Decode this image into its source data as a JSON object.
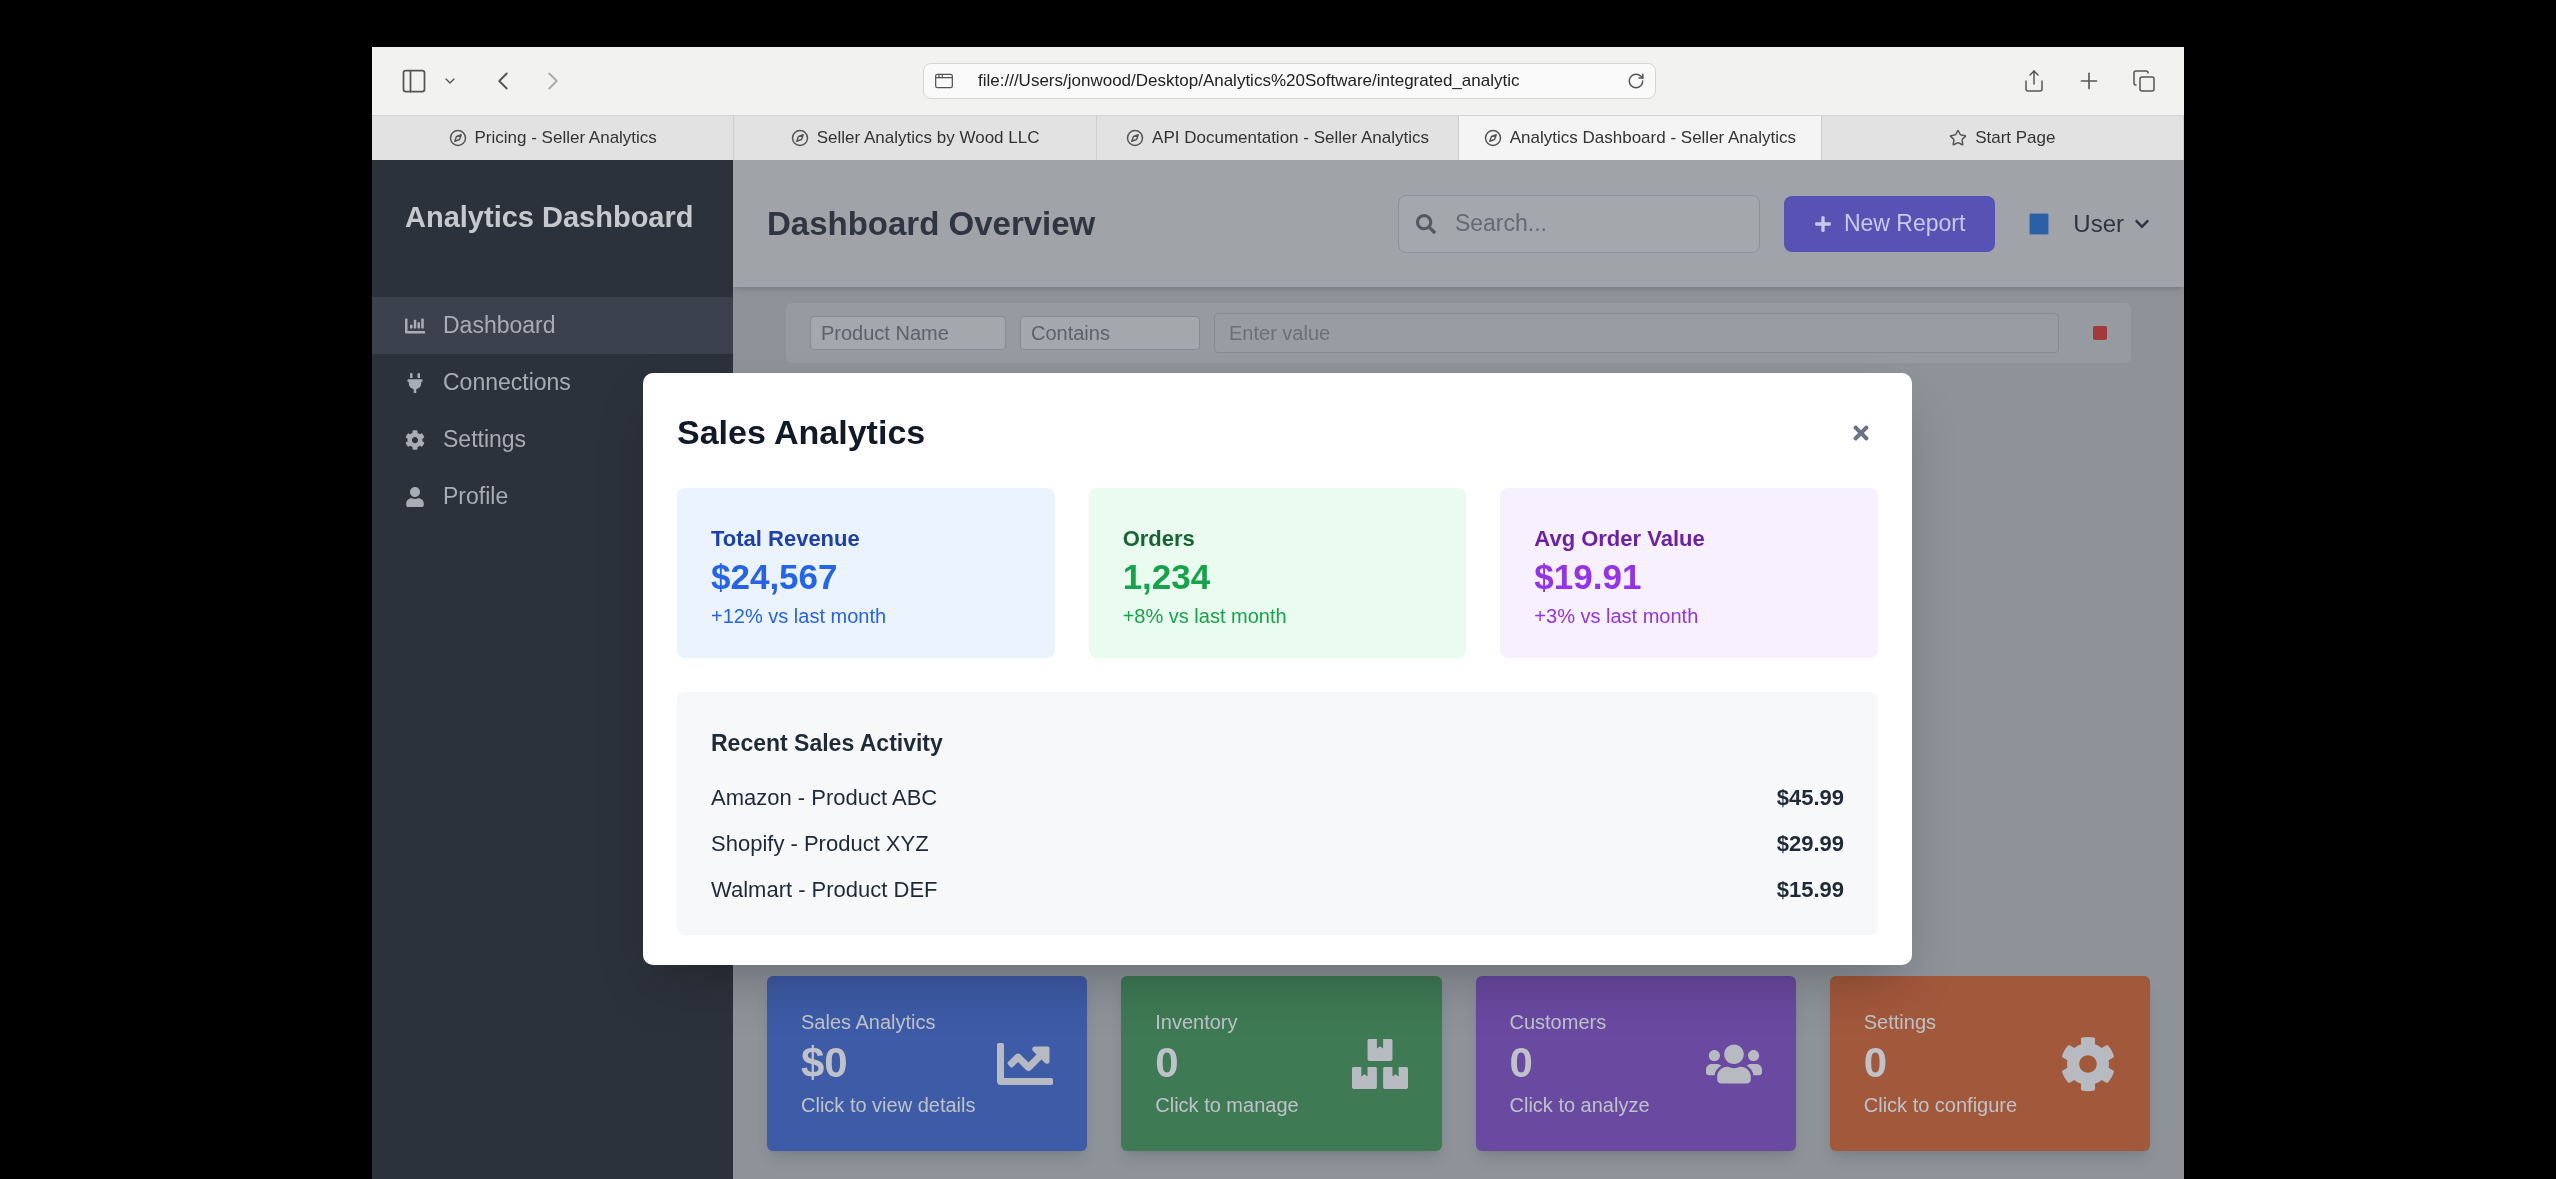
{
  "browser": {
    "url": "file:///Users/jonwood/Desktop/Analytics%20Software/integrated_analytic",
    "tabs": [
      {
        "title": "Pricing - Seller Analytics",
        "kind": "page",
        "selected": false
      },
      {
        "title": "Seller Analytics by Wood LLC",
        "kind": "page",
        "selected": false
      },
      {
        "title": "API Documentation - Seller Analytics",
        "kind": "page",
        "selected": false
      },
      {
        "title": "Analytics Dashboard - Seller Analytics",
        "kind": "page",
        "selected": true
      },
      {
        "title": "Start Page",
        "kind": "start",
        "selected": false
      }
    ]
  },
  "sidebar": {
    "title": "Analytics Dashboard",
    "items": [
      {
        "label": "Dashboard",
        "selected": true
      },
      {
        "label": "Connections",
        "selected": false
      },
      {
        "label": "Settings",
        "selected": false
      },
      {
        "label": "Profile",
        "selected": false
      }
    ]
  },
  "header": {
    "title": "Dashboard Overview",
    "search": {
      "placeholder": "Search..."
    },
    "new_report_button": "New Report",
    "user_label": "User"
  },
  "filter": {
    "field": "Product Name",
    "operator": "Contains",
    "value": {
      "placeholder": "Enter value"
    }
  },
  "summary_cards": [
    {
      "kind": "sales",
      "title": "Sales Analytics",
      "value": "$0",
      "caption": "Click to view details"
    },
    {
      "kind": "inventory",
      "title": "Inventory",
      "value": "0",
      "caption": "Click to manage"
    },
    {
      "kind": "customers",
      "title": "Customers",
      "value": "0",
      "caption": "Click to analyze"
    },
    {
      "kind": "settings",
      "title": "Settings",
      "value": "0",
      "caption": "Click to configure"
    }
  ],
  "modal": {
    "title": "Sales Analytics",
    "stats": [
      {
        "kind": "blue",
        "label": "Total Revenue",
        "value": "$24,567",
        "change": "+12% vs last month"
      },
      {
        "kind": "green",
        "label": "Orders",
        "value": "1,234",
        "change": "+8% vs last month"
      },
      {
        "kind": "purple",
        "label": "Avg Order Value",
        "value": "$19.91",
        "change": "+3% vs last month"
      }
    ],
    "recent": {
      "title": "Recent Sales Activity",
      "rows": [
        {
          "name": "Amazon - Product ABC",
          "amount": "$45.99"
        },
        {
          "name": "Shopify - Product XYZ",
          "amount": "$29.99"
        },
        {
          "name": "Walmart - Product DEF",
          "amount": "$15.99"
        }
      ]
    }
  }
}
